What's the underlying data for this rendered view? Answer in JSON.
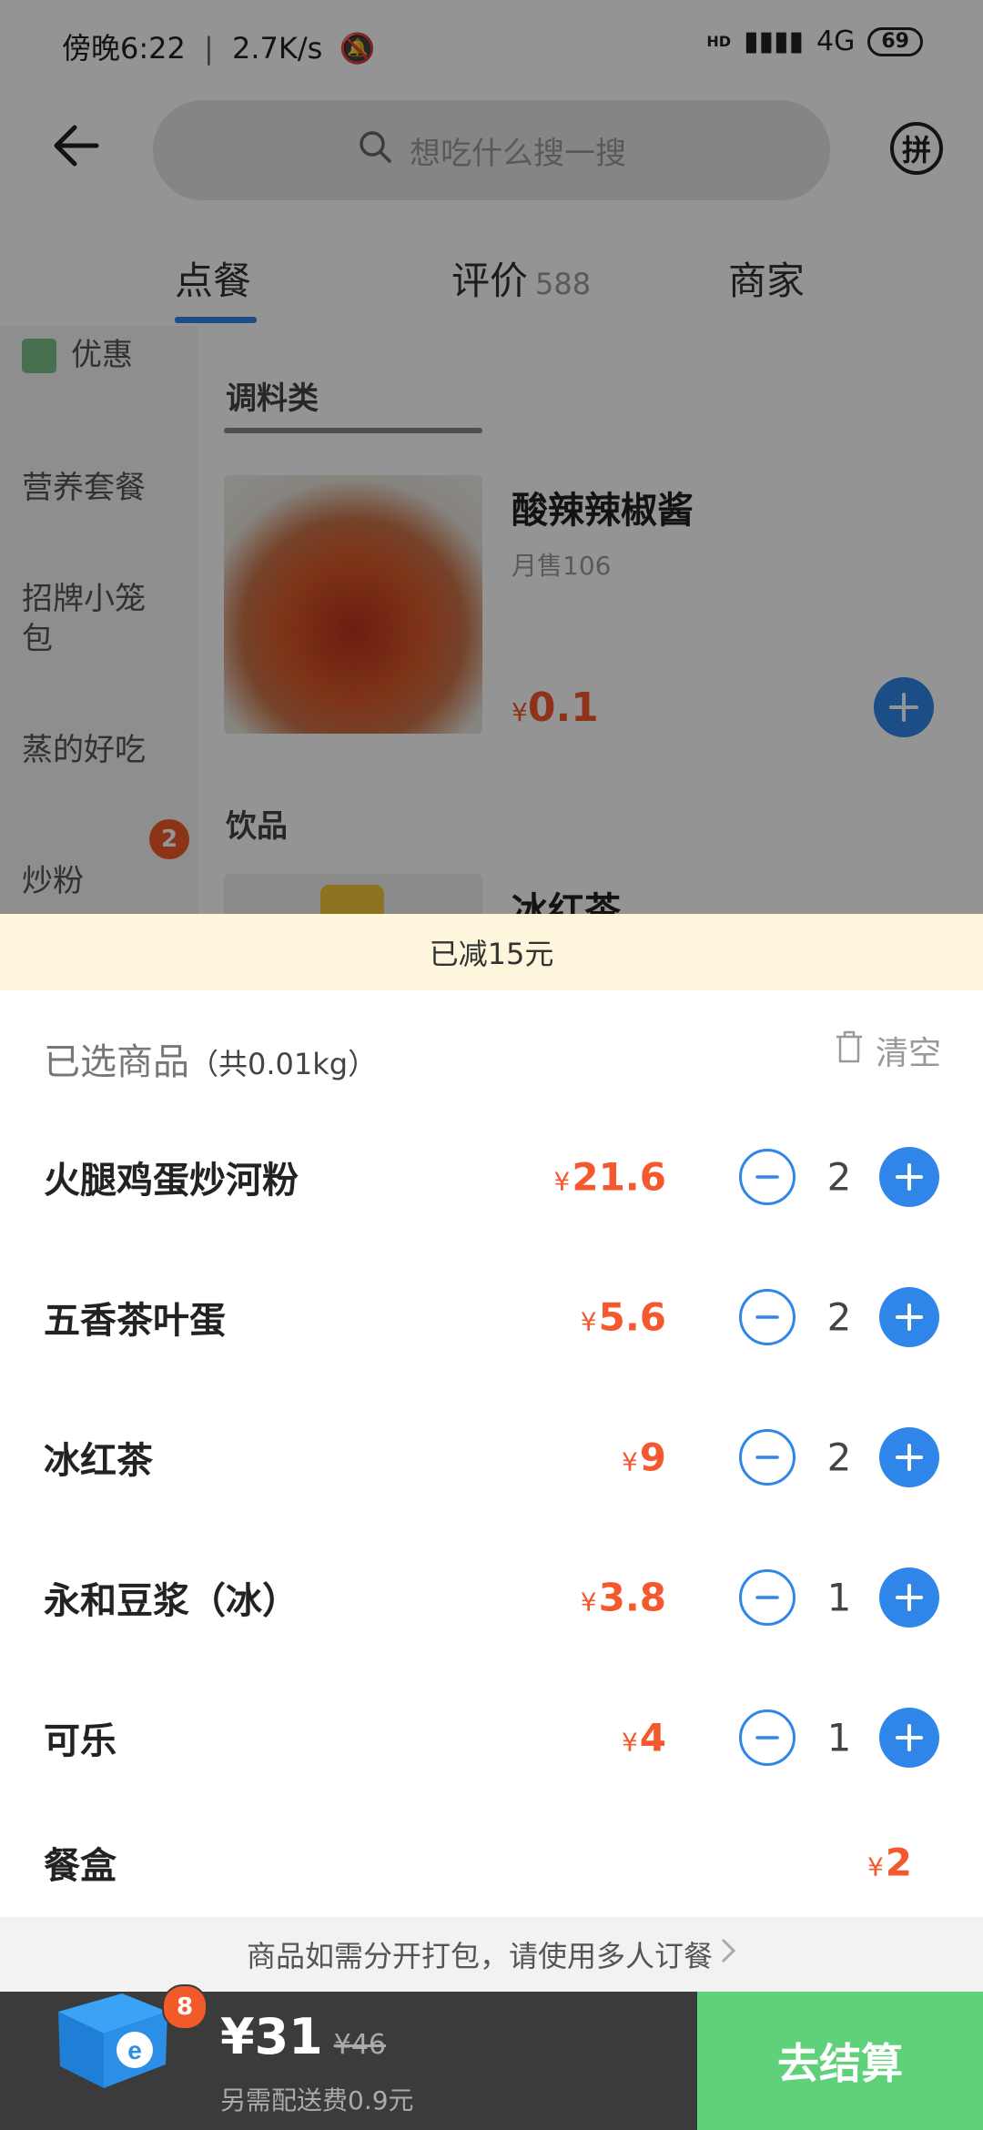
{
  "status_bar": {
    "time": "傍晚6:22",
    "speed": "2.7K/s",
    "network": "4G",
    "hd": "HD",
    "battery": "69"
  },
  "header": {
    "search_placeholder": "想吃什么搜一搜",
    "pin_label": "拼"
  },
  "tabs": [
    {
      "label": "点餐",
      "active": true
    },
    {
      "label": "评价",
      "count": "588"
    },
    {
      "label": "商家"
    }
  ],
  "sidebar": {
    "items": [
      {
        "label": "优惠"
      },
      {
        "label": "营养套餐"
      },
      {
        "label": "招牌小笼包"
      },
      {
        "label": "蒸的好吃"
      },
      {
        "label": "炒粉"
      }
    ],
    "badge_count": "2"
  },
  "menu": {
    "category_1": "调料类",
    "product_1": {
      "name": "酸辣辣椒酱",
      "sales": "月售106",
      "yen": "¥",
      "price": "0.1"
    },
    "category_2": "饮品",
    "product_2": {
      "name": "冰红茶"
    }
  },
  "discount_bar": "已减15元",
  "cart": {
    "title": "已选商品",
    "weight": "（共0.01kg）",
    "clear_label": "清空",
    "items": [
      {
        "name": "火腿鸡蛋炒河粉",
        "yen": "¥",
        "price": "21.6",
        "qty": "2"
      },
      {
        "name": "五香茶叶蛋",
        "yen": "¥",
        "price": "5.6",
        "qty": "2"
      },
      {
        "name": "冰红茶",
        "yen": "¥",
        "price": "9",
        "qty": "2"
      },
      {
        "name": "永和豆浆（冰）",
        "yen": "¥",
        "price": "3.8",
        "qty": "1"
      },
      {
        "name": "可乐",
        "yen": "¥",
        "price": "4",
        "qty": "1"
      }
    ],
    "box": {
      "name": "餐盒",
      "yen": "¥",
      "price": "2"
    }
  },
  "notice": "商品如需分开打包，请使用多人订餐",
  "footer": {
    "cart_count": "8",
    "total": "¥31",
    "original": "¥46",
    "delivery_fee": "另需配送费0.9元",
    "checkout_label": "去结算"
  },
  "colors": {
    "accent_blue": "#2f86e8",
    "price_red": "#f4582e",
    "checkout_green": "#5ed17a",
    "footer_dark": "#3b3b3b"
  }
}
